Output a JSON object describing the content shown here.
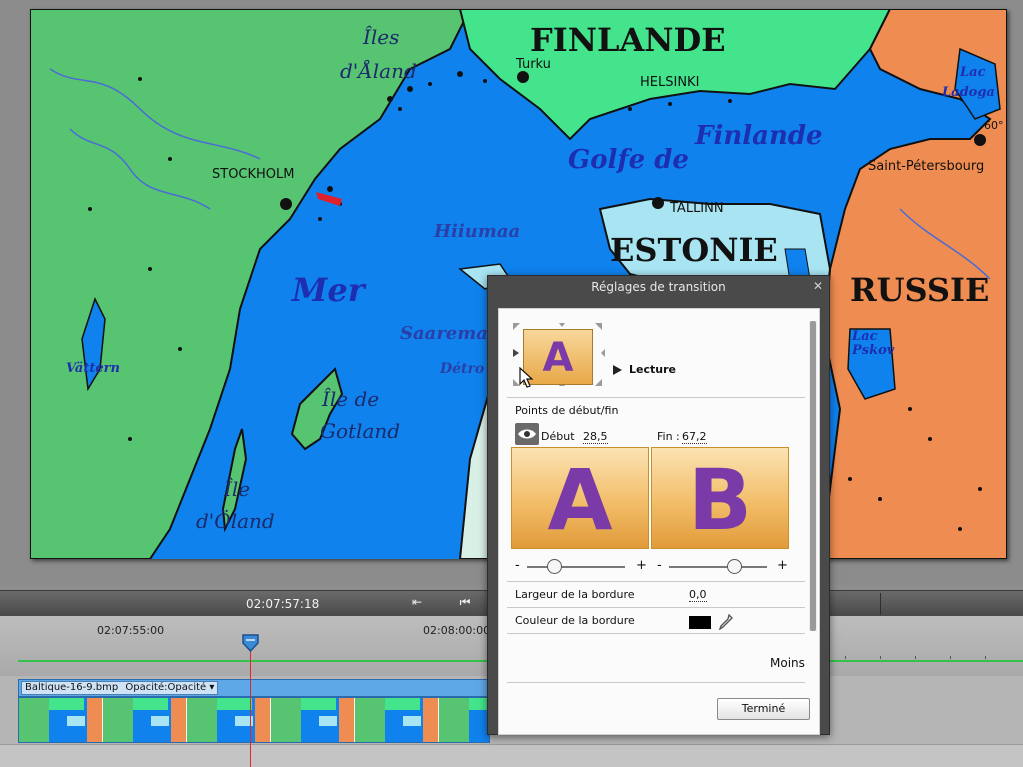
{
  "map": {
    "countries": {
      "finland": "FINLANDE",
      "estonia": "ESTONIE",
      "russia": "RUSSIE"
    },
    "seas": {
      "mer": "Mer",
      "golfe": "Golfe de",
      "finlande": "Finlande"
    },
    "islands": {
      "aland_1": "Îles",
      "aland_2": "d'Åland",
      "gotland_1": "Île de",
      "gotland_2": "Gotland",
      "oland_1": "Île",
      "oland_2": "d'Öland",
      "hiiumaa": "Hiiumaa",
      "saaremaa": "Saarema",
      "detroit": "Détro"
    },
    "cities": {
      "stockholm": "STOCKHOLM",
      "turku": "Turku",
      "helsinki": "HELSINKI",
      "tallinn": "TALLINN",
      "spb": "Saint-Pétersbourg",
      "lat": "60°"
    },
    "lakes": {
      "vattern": "Vättern",
      "ladoga_1": "Lac",
      "ladoga_2": "Ladoga",
      "pskov_1": "Lac",
      "pskov_2": "Pskov"
    },
    "colors": {
      "sea": "#0f82ee",
      "sweden": "#57c472",
      "finland": "#43e48c",
      "estonia": "#a8e4f2",
      "russia": "#ef8c52"
    }
  },
  "timeline": {
    "current_time": "02:07:57:18",
    "ruler_left": "02:07:55:00",
    "ruler_right": "02:08:00:00",
    "clip_name": "Baltique-16-9.bmp",
    "clip_effect": "Opacité:Opacité",
    "clip_effect_icon": "chevron-down-icon",
    "toolbar_icons": [
      "marker-icon",
      "skip-to-start-icon"
    ]
  },
  "dialog": {
    "title": "Réglages de transition",
    "close_icon": "close-icon",
    "lecture": "Lecture",
    "section_label": "Points de début/fin",
    "start_label": "Début",
    "start_value": "28,5",
    "end_label": "Fin :",
    "end_value": "67,2",
    "letter_a": "A",
    "letter_b": "B",
    "preview_letter": "A",
    "minus": "-",
    "plus": "+",
    "border_width_label": "Largeur de la bordure",
    "border_width_value": "0,0",
    "border_color_label": "Couleur de la bordure",
    "border_color": "#000000",
    "less_label": "Moins",
    "done_label": "Terminé",
    "slider_a_fraction": 0.285,
    "slider_b_fraction": 0.672
  }
}
